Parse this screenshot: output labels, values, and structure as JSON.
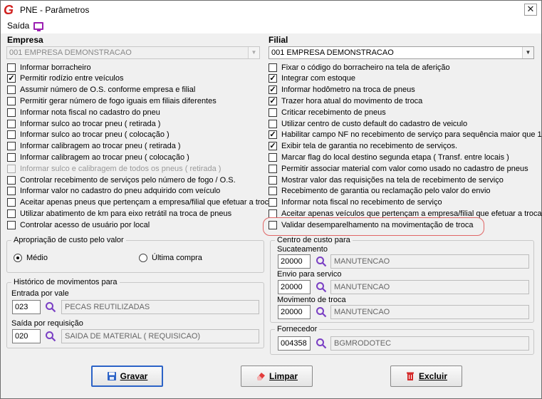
{
  "window": {
    "title": "PNE - Parâmetros",
    "close": "✕"
  },
  "menu": {
    "saida": "Saída"
  },
  "empresa": {
    "label": "Empresa",
    "value": "001 EMPRESA DEMONSTRACAO"
  },
  "filial": {
    "label": "Filial",
    "value": "001 EMPRESA DEMONSTRACAO"
  },
  "left_checks": [
    {
      "label": "Informar borracheiro",
      "checked": false,
      "disabled": false
    },
    {
      "label": "Permitir rodízio entre veículos",
      "checked": true,
      "disabled": false
    },
    {
      "label": "Assumir número de O.S. conforme empresa e filial",
      "checked": false,
      "disabled": false
    },
    {
      "label": "Permitir gerar número de fogo iguais em filiais diferentes",
      "checked": false,
      "disabled": false
    },
    {
      "label": "Informar nota fiscal no cadastro do pneu",
      "checked": false,
      "disabled": false
    },
    {
      "label": "Informar sulco ao trocar pneu ( retirada )",
      "checked": false,
      "disabled": false
    },
    {
      "label": "Informar sulco ao trocar pneu ( colocação )",
      "checked": false,
      "disabled": false
    },
    {
      "label": "Informar calibragem ao trocar pneu ( retirada )",
      "checked": false,
      "disabled": false
    },
    {
      "label": "Informar calibragem ao trocar pneu ( colocação )",
      "checked": false,
      "disabled": false
    },
    {
      "label": "Informar sulco e calibragem de todos os pneus ( retirada )",
      "checked": false,
      "disabled": true
    },
    {
      "label": "Controlar recebimento de serviços pelo número de fogo / O.S.",
      "checked": false,
      "disabled": false
    },
    {
      "label": "Informar valor no cadastro do pneu adquirido com veículo",
      "checked": false,
      "disabled": false
    },
    {
      "label": "Aceitar apenas pneus que pertençam a empresa/filial que efetuar a troca",
      "checked": false,
      "disabled": false
    },
    {
      "label": "Utilizar abatimento de km para eixo retrátil na troca de pneus",
      "checked": false,
      "disabled": false
    },
    {
      "label": "Controlar acesso de usuário por local",
      "checked": false,
      "disabled": false
    }
  ],
  "right_checks": [
    {
      "label": "Fixar o código do borracheiro na tela de aferição",
      "checked": false
    },
    {
      "label": "Integrar com estoque",
      "checked": true
    },
    {
      "label": "Informar hodômetro na troca de pneus",
      "checked": true
    },
    {
      "label": "Trazer hora atual do movimento de troca",
      "checked": true
    },
    {
      "label": "Criticar recebimento de pneus",
      "checked": false
    },
    {
      "label": "Utilizar centro de custo default do cadastro de veiculo",
      "checked": false
    },
    {
      "label": "Habilitar campo NF no recebimento de serviço para sequência maior que 1",
      "checked": true
    },
    {
      "label": "Exibir tela de garantia no recebimento de serviços.",
      "checked": true
    },
    {
      "label": "Marcar flag do local destino segunda etapa ( Transf. entre locais )",
      "checked": false
    },
    {
      "label": "Permitir associar material com valor como usado no cadastro de pneus",
      "checked": false
    },
    {
      "label": "Mostrar valor das requisições na tela de recebimento de serviço",
      "checked": false
    },
    {
      "label": "Recebimento de garantia ou reclamação pelo valor do envio",
      "checked": false
    },
    {
      "label": "Informar nota fiscal no recebimento de serviço",
      "checked": false
    },
    {
      "label": "Aceitar apenas veículos que pertençam a empresa/filial que efetuar a troca",
      "checked": false
    },
    {
      "label": "Validar desemparelhamento na movimentação de troca",
      "checked": false
    }
  ],
  "apropriacao": {
    "label": "Apropriação de custo pelo valor",
    "medio": "Médio",
    "ultima": "Última compra",
    "selected": "medio"
  },
  "historico": {
    "label": "Histórico de movimentos para",
    "entrada_label": "Entrada por vale",
    "entrada_code": "023",
    "entrada_desc": "PECAS REUTILIZADAS",
    "saida_label": "Saída por requisição",
    "saida_code": "020",
    "saida_desc": "SAIDA DE MATERIAL ( REQUISICAO)"
  },
  "centro": {
    "label": "Centro de custo para",
    "sucateamento_label": "Sucateamento",
    "sucateamento_code": "20000",
    "sucateamento_desc": "MANUTENCAO",
    "envio_label": "Envio para servico",
    "envio_code": "20000",
    "envio_desc": "MANUTENCAO",
    "mov_label": "Movimento de troca",
    "mov_code": "20000",
    "mov_desc": "MANUTENCAO"
  },
  "fornecedor": {
    "label": "Fornecedor",
    "code": "004358",
    "desc": "BGMRODOTEC"
  },
  "buttons": {
    "gravar": "Gravar",
    "limpar": "Limpar",
    "excluir": "Excluir"
  },
  "colors": {
    "accent": "#2c63c7",
    "highlight": "#e06666",
    "logo": "#d0201e",
    "monitor": "#9b1fb2"
  }
}
